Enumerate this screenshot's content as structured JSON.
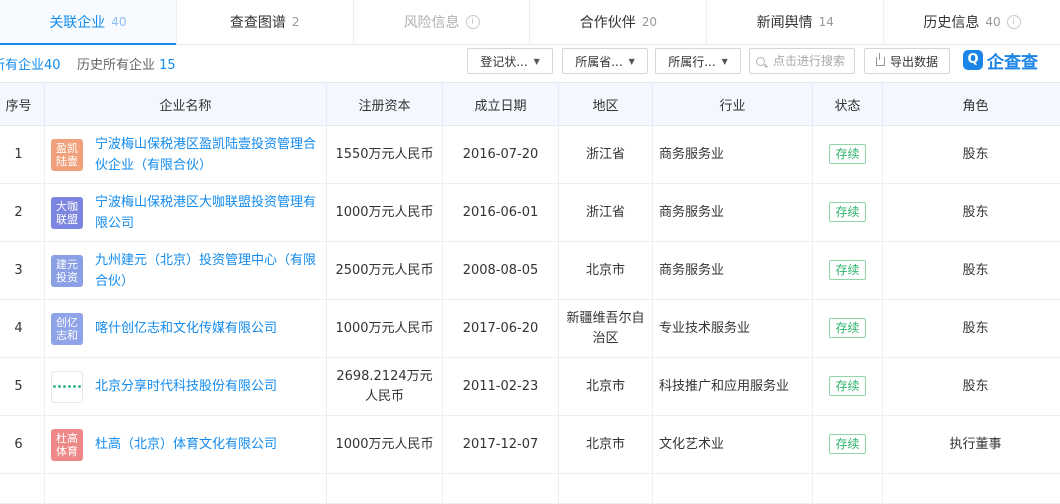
{
  "tabs": [
    {
      "label": "关联企业",
      "count": "40",
      "state": "active"
    },
    {
      "label": "查查图谱",
      "count": "2",
      "state": "normal"
    },
    {
      "label": "风险信息",
      "count": "",
      "state": "disabled",
      "info": true
    },
    {
      "label": "合作伙伴",
      "count": "20",
      "state": "normal"
    },
    {
      "label": "新闻舆情",
      "count": "14",
      "state": "normal"
    },
    {
      "label": "历史信息",
      "count": "40",
      "state": "normal",
      "info": true
    }
  ],
  "info_glyph": "i",
  "subtabs": {
    "current": {
      "label": "所有企业",
      "count": "40"
    },
    "history": {
      "label": "历史所有企业",
      "count": "15"
    }
  },
  "filters": {
    "registration_status": "登记状...",
    "province": "所属省...",
    "industry": "所属行..."
  },
  "caret": "▼",
  "search": {
    "placeholder": "点击进行搜索",
    "value": ""
  },
  "export_label": "导出数据",
  "brand": {
    "mark": "Q",
    "name": "企查查",
    "color": "#1a85e6"
  },
  "accent_color": "#128bed",
  "status_color": "#2db56b",
  "table": {
    "columns": [
      "序号",
      "企业名称",
      "注册资本",
      "成立日期",
      "地区",
      "行业",
      "状态",
      "角色"
    ],
    "rows": [
      {
        "no": "1",
        "logo_text": "盈凯\n陆壹",
        "logo_color": "#f0a07a",
        "name": "宁波梅山保税港区盈凯陆壹投资管理合伙企业（有限合伙）",
        "capital": "1550万元人民币",
        "date": "2016-07-20",
        "region": "浙江省",
        "industry": "商务服务业",
        "status": "存续",
        "role": "股东"
      },
      {
        "no": "2",
        "logo_text": "大咖\n联盟",
        "logo_color": "#7c85e0",
        "name": "宁波梅山保税港区大咖联盟投资管理有限公司",
        "capital": "1000万元人民币",
        "date": "2016-06-01",
        "region": "浙江省",
        "industry": "商务服务业",
        "status": "存续",
        "role": "股东"
      },
      {
        "no": "3",
        "logo_text": "建元\n投资",
        "logo_color": "#8a9fe6",
        "name": "九州建元（北京）投资管理中心（有限合伙）",
        "capital": "2500万元人民币",
        "date": "2008-08-05",
        "region": "北京市",
        "industry": "商务服务业",
        "status": "存续",
        "role": "股东"
      },
      {
        "no": "4",
        "logo_text": "创亿\n志和",
        "logo_color": "#8fa3e8",
        "name": "喀什创亿志和文化传媒有限公司",
        "capital": "1000万元人民币",
        "date": "2017-06-20",
        "region": "新疆维吾尔自治区",
        "industry": "专业技术服务业",
        "status": "存续",
        "role": "股东"
      },
      {
        "no": "5",
        "logo_text": "",
        "logo_color": "#ffffff",
        "logo_icon": "share-dots",
        "name": "北京分享时代科技股份有限公司",
        "capital": "2698.2124万元人民币",
        "date": "2011-02-23",
        "region": "北京市",
        "industry": "科技推广和应用服务业",
        "status": "存续",
        "role": "股东"
      },
      {
        "no": "6",
        "logo_text": "杜高\n体育",
        "logo_color": "#ee8888",
        "name": "杜高（北京）体育文化有限公司",
        "capital": "1000万元人民币",
        "date": "2017-12-07",
        "region": "北京市",
        "industry": "文化艺术业",
        "status": "存续",
        "role": "执行董事"
      }
    ]
  }
}
